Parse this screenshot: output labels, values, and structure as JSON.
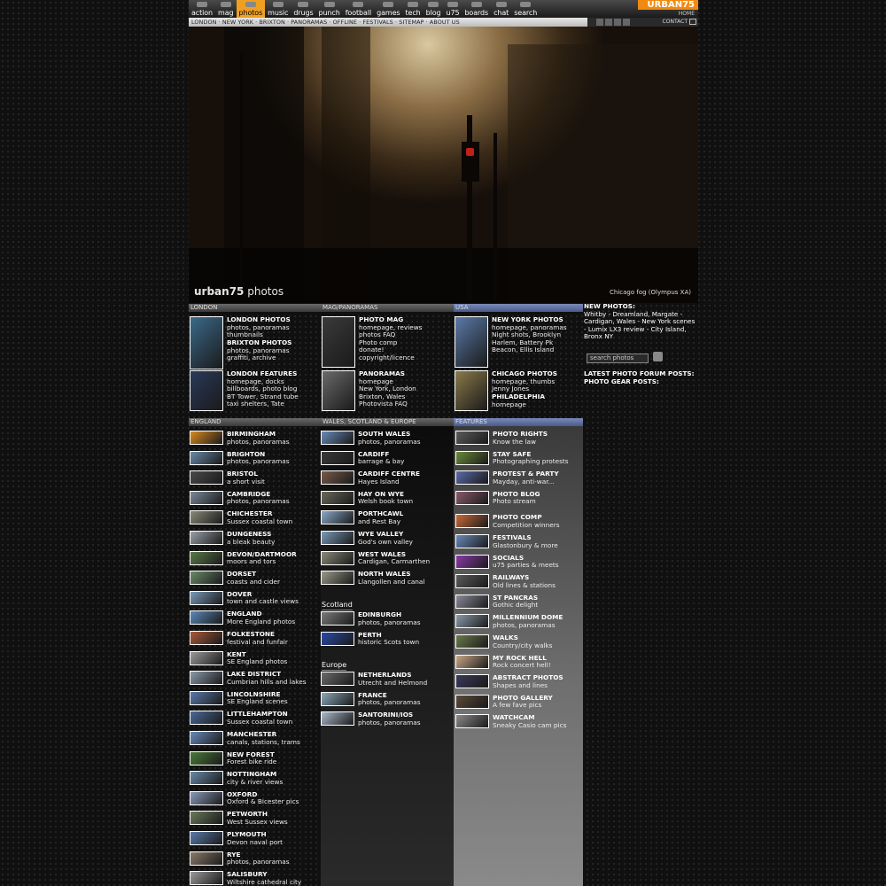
{
  "nav": {
    "items": [
      "action",
      "mag",
      "photos",
      "music",
      "drugs",
      "punch",
      "football",
      "games",
      "tech",
      "blog",
      "u75",
      "boards",
      "chat",
      "search"
    ],
    "active": "photos",
    "brand": "URBAN75",
    "home": "HOME",
    "links": "LONDON · NEW YORK · BRIXTON · PANORAMAS · OFFLINE · FESTIVALS · SITEMAP · ABOUT US",
    "contact": "CONTACT"
  },
  "hero": {
    "site_name": "urban75",
    "site_suffix": "photos",
    "caption": "Chicago fog (Olympus XA)"
  },
  "sections": {
    "london": {
      "title": "LONDON",
      "items": [
        {
          "title": "LONDON PHOTOS",
          "lines": [
            "photos, panoramas",
            "thumbnails"
          ],
          "color": "#3b6a8a"
        },
        {
          "title": "BRIXTON PHOTOS",
          "lines": [
            "photos, panoramas",
            "graffiti, archive"
          ],
          "color": "#7a4a20"
        },
        {
          "title": "LONDON FEATURES",
          "lines": [
            "homepage, docks",
            "billboards, photo blog",
            "BT Tower, Strand tube",
            "taxi shelters, Tate"
          ],
          "color": "#2a3a5a"
        }
      ]
    },
    "mag": {
      "title": "MAG/PANORAMAS",
      "items": [
        {
          "title": "PHOTO MAG",
          "lines": [
            "homepage, reviews",
            "photos FAQ",
            "Photo comp",
            "donate!",
            "copyright/licence"
          ],
          "color": "#3a3a3a"
        },
        {
          "title": "PANORAMAS",
          "lines": [
            "homepage",
            "New York, London",
            "Brixton, Wales",
            "Photovista FAQ"
          ],
          "color": "#6a6a6a"
        }
      ]
    },
    "usa": {
      "title": "USA",
      "items": [
        {
          "title": "NEW YORK PHOTOS",
          "lines": [
            "homepage, panoramas",
            "Night shots, Brooklyn",
            "Harlem, Battery Pk",
            "Beacon, Ellis Island"
          ],
          "color": "#5a7aa8"
        },
        {
          "title": "CHICAGO PHOTOS",
          "lines": [
            "homepage, thumbs",
            "Jenny Jones"
          ],
          "color": "#8a7a4a"
        },
        {
          "title": "PHILADELPHIA",
          "lines": [
            "homepage"
          ],
          "color": "#8a7a4a"
        }
      ]
    },
    "side": {
      "new_photos_label": "NEW PHOTOS:",
      "new_photos": "Whitby - Dreamland, Margate - Cardigan, Wales - New York scenes - Lumix LX3 review - City Island, Bronx NY",
      "search_placeholder": "search photos",
      "forum_label": "LATEST PHOTO FORUM POSTS:",
      "gear_label": "PHOTO GEAR POSTS:"
    },
    "england": {
      "title": "ENGLAND",
      "items": [
        {
          "title": "BIRMINGHAM",
          "sub": "photos, panoramas",
          "color": "#d88a20"
        },
        {
          "title": "BRIGHTON",
          "sub": "photos, panoramas",
          "color": "#6a8aa8"
        },
        {
          "title": "BRISTOL",
          "sub": "a short visit",
          "color": "#4a4a4a"
        },
        {
          "title": "CAMBRIDGE",
          "sub": "photos, panoramas",
          "color": "#7a8a9a"
        },
        {
          "title": "CHICHESTER",
          "sub": "Sussex coastal town",
          "color": "#8a8a7a"
        },
        {
          "title": "DUNGENESS",
          "sub": "a bleak beauty",
          "color": "#9aa0a8"
        },
        {
          "title": "DEVON/DARTMOOR",
          "sub": "moors and tors",
          "color": "#5a7a4a"
        },
        {
          "title": "DORSET",
          "sub": "coasts and cider",
          "color": "#6a8a6a"
        },
        {
          "title": "DOVER",
          "sub": "town and castle views",
          "color": "#7a9ab8"
        },
        {
          "title": "ENGLAND",
          "sub": "More England photos",
          "color": "#5a8ab8"
        },
        {
          "title": "FOLKESTONE",
          "sub": "festival and funfair",
          "color": "#a85a3a"
        },
        {
          "title": "KENT",
          "sub": "SE England photos",
          "color": "#9a9a9a"
        },
        {
          "title": "LAKE DISTRICT",
          "sub": "Cumbrian hills and lakes",
          "color": "#8a9aa8"
        },
        {
          "title": "LINCOLNSHIRE",
          "sub": "SE England scenes",
          "color": "#5a7aa8"
        },
        {
          "title": "LITTLEHAMPTON",
          "sub": "Sussex coastal town",
          "color": "#4a6a9a"
        },
        {
          "title": "MANCHESTER",
          "sub": "canals, stations, trams",
          "color": "#6a8ab8"
        },
        {
          "title": "NEW FOREST",
          "sub": "Forest bike ride",
          "color": "#4a7a3a"
        },
        {
          "title": "NOTTINGHAM",
          "sub": "city & river views",
          "color": "#6a8aa8"
        },
        {
          "title": "OXFORD",
          "sub": "Oxford & Bicester pics",
          "color": "#8a9ab8"
        },
        {
          "title": "PETWORTH",
          "sub": "West Sussex views",
          "color": "#6a7a5a"
        },
        {
          "title": "PLYMOUTH",
          "sub": "Devon naval port",
          "color": "#5a7aa8"
        },
        {
          "title": "RYE",
          "sub": "photos, panoramas",
          "color": "#8a7a6a"
        },
        {
          "title": "SALISBURY",
          "sub": "Wiltshire cathedral city",
          "color": "#9a9a9a"
        }
      ]
    },
    "wales": {
      "title": "WALES, SCOTLAND & EUROPE",
      "items": [
        {
          "title": "SOUTH WALES",
          "sub": "photos, panoramas",
          "color": "#6a8ab8"
        },
        {
          "title": "CARDIFF",
          "sub": "barrage & bay",
          "color": "#3a3a3a"
        },
        {
          "title": "CARDIFF CENTRE",
          "sub": "Hayes Island",
          "color": "#7a5a4a"
        },
        {
          "title": "HAY ON WYE",
          "sub": "Welsh book town",
          "color": "#6a6a5a"
        },
        {
          "title": "PORTHCAWL",
          "sub": "and Rest Bay",
          "color": "#8aa8c8"
        },
        {
          "title": "WYE VALLEY",
          "sub": "God's own valley",
          "color": "#7a9ab8"
        },
        {
          "title": "WEST WALES",
          "sub": "Cardigan, Carmarthen",
          "color": "#8a8a7a"
        },
        {
          "title": "NORTH WALES",
          "sub": "Llangollen and canal",
          "color": "#9a9a8a"
        }
      ]
    },
    "scotland": {
      "title": "Scotland",
      "items": [
        {
          "title": "EDINBURGH",
          "sub": "photos, panoramas",
          "color": "#7a7a7a"
        },
        {
          "title": "PERTH",
          "sub": "historic Scots town",
          "color": "#2a4aa8"
        }
      ]
    },
    "europe": {
      "title": "Europe",
      "items": [
        {
          "title": "NETHERLANDS",
          "sub": "Utrecht and Helmond",
          "color": "#6a6a6a"
        },
        {
          "title": "FRANCE",
          "sub": "photos, panoramas",
          "color": "#8aa8b8"
        },
        {
          "title": "SANTORINI/IOS",
          "sub": "photos, panoramas",
          "color": "#aabacc"
        }
      ]
    },
    "features": {
      "title": "FEATURES",
      "items": [
        {
          "title": "PHOTO RIGHTS",
          "sub": "Know the law",
          "color": "#5a5a5a"
        },
        {
          "title": "STAY SAFE",
          "sub": "Photographing protests",
          "color": "#6a8a3a"
        },
        {
          "title": "PROTEST & PARTY",
          "sub": "Mayday, anti-war...",
          "color": "#5a6aa8"
        },
        {
          "title": "PHOTO BLOG",
          "sub": "Photo stream",
          "color": "#8a5a6a"
        },
        {
          "title": "PHOTO COMP",
          "sub": "Competition winners",
          "color": "#c86a3a"
        },
        {
          "title": "FESTIVALS",
          "sub": "Glastonbury & more",
          "color": "#6a8ab8"
        },
        {
          "title": "SOCIALS",
          "sub": "u75 parties & meets",
          "color": "#8a3aa8"
        },
        {
          "title": "RAILWAYS",
          "sub": "Old lines & stations",
          "color": "#5a5a5a"
        },
        {
          "title": "ST PANCRAS",
          "sub": "Gothic delight",
          "color": "#8a8a9a"
        },
        {
          "title": "MILLENNIUM DOME",
          "sub": "photos, panoramas",
          "color": "#8a9aa8"
        },
        {
          "title": "WALKS",
          "sub": "Country/city walks",
          "color": "#6a7a4a"
        },
        {
          "title": "MY ROCK HELL",
          "sub": "Rock concert hell!",
          "color": "#c8a888"
        },
        {
          "title": "ABSTRACT PHOTOS",
          "sub": "Shapes and lines",
          "color": "#3a3a5a"
        },
        {
          "title": "PHOTO GALLERY",
          "sub": "A few fave pics",
          "color": "#5a4a3a"
        },
        {
          "title": "WATCHCAM",
          "sub": "Sneaky Casio cam pics",
          "color": "#8a8a8a"
        }
      ]
    }
  }
}
